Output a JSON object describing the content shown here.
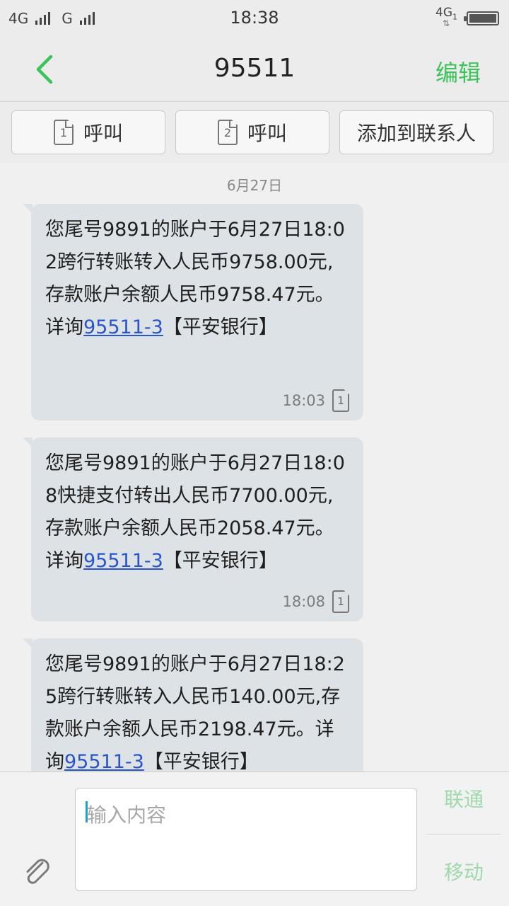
{
  "status": {
    "net1": "4G",
    "net2": "G",
    "time": "18:38",
    "net3": "4G",
    "net3_sub": "1"
  },
  "header": {
    "title": "95511",
    "edit": "编辑"
  },
  "actions": [
    {
      "sim": "1",
      "label": "呼叫"
    },
    {
      "sim": "2",
      "label": "呼叫"
    },
    {
      "label": "添加到联系人"
    }
  ],
  "conversation": {
    "date": "6月27日",
    "messages": [
      {
        "text_before": "您尾号9891的账户于6月27日18:02跨行转账转入人民币9758.00元,存款账户余额人民币9758.47元。详询",
        "link": "95511-3",
        "text_after": "【平安银行】",
        "time": "18:03",
        "sim": "1"
      },
      {
        "text_before": "您尾号9891的账户于6月27日18:08快捷支付转出人民币7700.00元,存款账户余额人民币2058.47元。详询",
        "link": "95511-3",
        "text_after": "【平安银行】",
        "time": "18:08",
        "sim": "1"
      },
      {
        "text_before": "您尾号9891的账户于6月27日18:25跨行转账转入人民币140.00元,存款账户余额人民币2198.47元。详询",
        "link": "95511-3",
        "text_after": "【平安银行】"
      }
    ]
  },
  "composer": {
    "placeholder": "输入内容",
    "sim1_carrier": "联通",
    "sim2_carrier": "移动"
  },
  "colors": {
    "accent": "#3cc35a",
    "bubble": "#dde2e6",
    "link": "#2a55c9"
  }
}
